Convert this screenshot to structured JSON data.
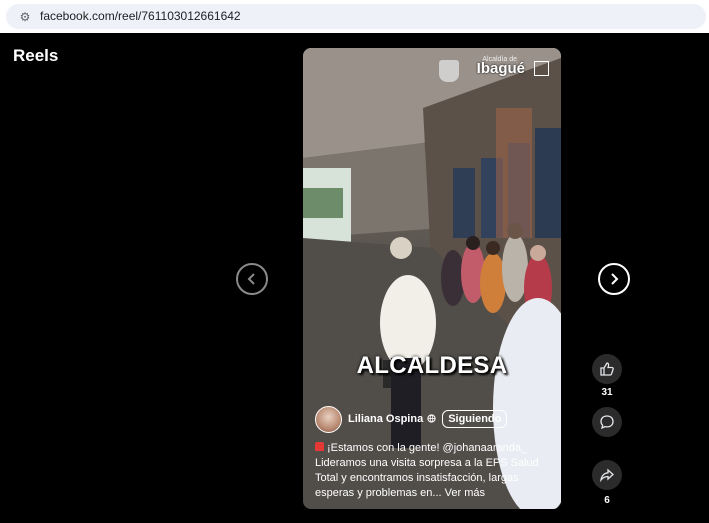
{
  "browser": {
    "url": "facebook.com/reel/761103012661642",
    "site_icon": "site-settings-icon"
  },
  "page": {
    "title": "Reels"
  },
  "reel": {
    "watermark_small": "Alcaldía de",
    "watermark_text": "Ibagué",
    "caption_word": "ALCALDESA",
    "author": {
      "name": "Liliana Ospina",
      "follow_label": "Siguiendo"
    },
    "description": "¡Estamos con la gente! @johanaaranda_ Lideramos una visita sorpresa a la EPS Salud Total y encontramos insatisfacción, largas esperas y problemas en...",
    "see_more": "Ver más"
  },
  "actions": {
    "like_count": "31",
    "comment_count": "",
    "share_count": "6"
  },
  "nav": {
    "prev_icon": "chevron-left-icon",
    "next_icon": "chevron-right-icon"
  }
}
